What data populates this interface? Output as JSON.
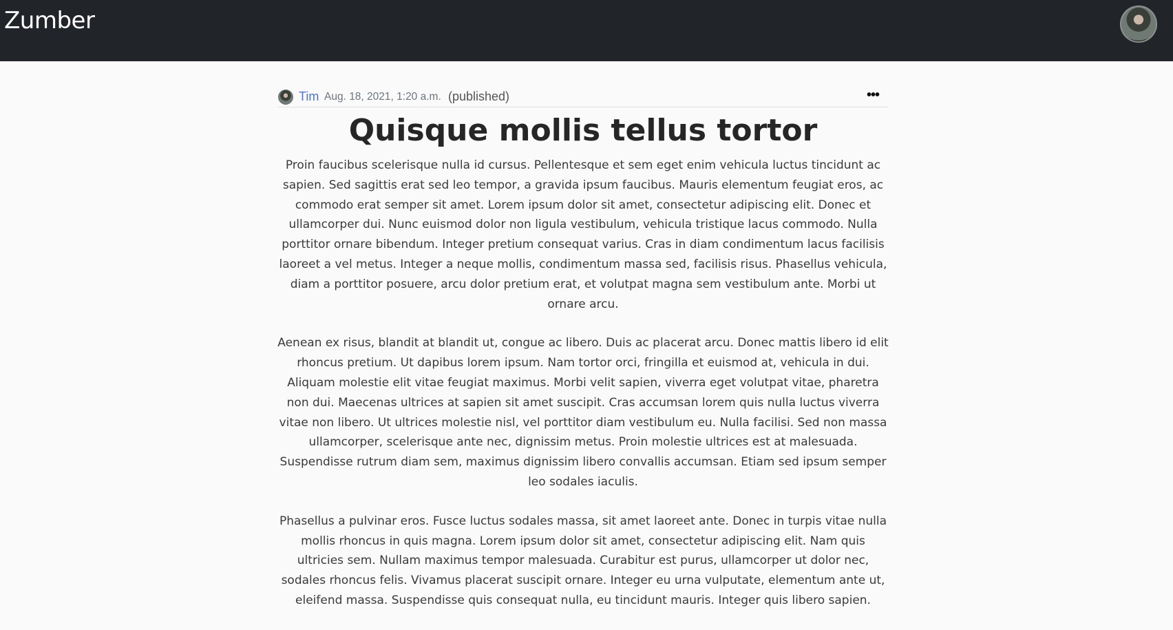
{
  "navbar": {
    "brand": "Zumber",
    "avatar_icon": "user-avatar-icon"
  },
  "post": {
    "author": "Tim",
    "date": "Aug. 18, 2021, 1:20 a.m.",
    "status": "(published)",
    "menu_label": "•••",
    "title": "Quisque mollis tellus tortor",
    "paragraphs": [
      "Proin faucibus scelerisque nulla id cursus. Pellentesque et sem eget enim vehicula luctus tincidunt ac sapien. Sed sagittis erat sed leo tempor, a gravida ipsum faucibus. Mauris elementum feugiat eros, ac commodo erat semper sit amet. Lorem ipsum dolor sit amet, consectetur adipiscing elit. Donec et ullamcorper dui. Nunc euismod dolor non ligula vestibulum, vehicula tristique lacus commodo. Nulla porttitor ornare bibendum. Integer pretium consequat varius. Cras in diam condimentum lacus facilisis laoreet a vel metus. Integer a neque mollis, condimentum massa sed, facilisis risus. Phasellus vehicula, diam a porttitor posuere, arcu dolor pretium erat, et volutpat magna sem vestibulum ante. Morbi ut ornare arcu.",
      "Aenean ex risus, blandit at blandit ut, congue ac libero. Duis ac placerat arcu. Donec mattis libero id elit rhoncus pretium. Ut dapibus lorem ipsum. Nam tortor orci, fringilla et euismod at, vehicula in dui. Aliquam molestie elit vitae feugiat maximus. Morbi velit sapien, viverra eget volutpat vitae, pharetra non dui. Maecenas ultrices at sapien sit amet suscipit. Cras accumsan lorem quis nulla luctus viverra vitae non libero. Ut ultrices molestie nisl, vel porttitor diam vestibulum eu. Nulla facilisi. Sed non massa ullamcorper, scelerisque ante nec, dignissim metus. Proin molestie ultrices est at malesuada. Suspendisse rutrum diam sem, maximus dignissim libero convallis accumsan. Etiam sed ipsum semper leo sodales iaculis.",
      "Phasellus a pulvinar eros. Fusce luctus sodales massa, sit amet laoreet ante. Donec in turpis vitae nulla mollis rhoncus in quis magna. Lorem ipsum dolor sit amet, consectetur adipiscing elit. Nam quis ultricies sem. Nullam maximus tempor malesuada. Curabitur est purus, ullamcorper ut dolor nec, sodales rhoncus felis. Vivamus placerat suscipit ornare. Integer eu urna vulputate, elementum ante ut, eleifend massa. Suspendisse quis consequat nulla, eu tincidunt mauris. Integer quis libero sapien."
    ]
  },
  "colors": {
    "navbar_bg": "#212529",
    "page_bg": "#fafafa",
    "link": "#4e73c8"
  }
}
